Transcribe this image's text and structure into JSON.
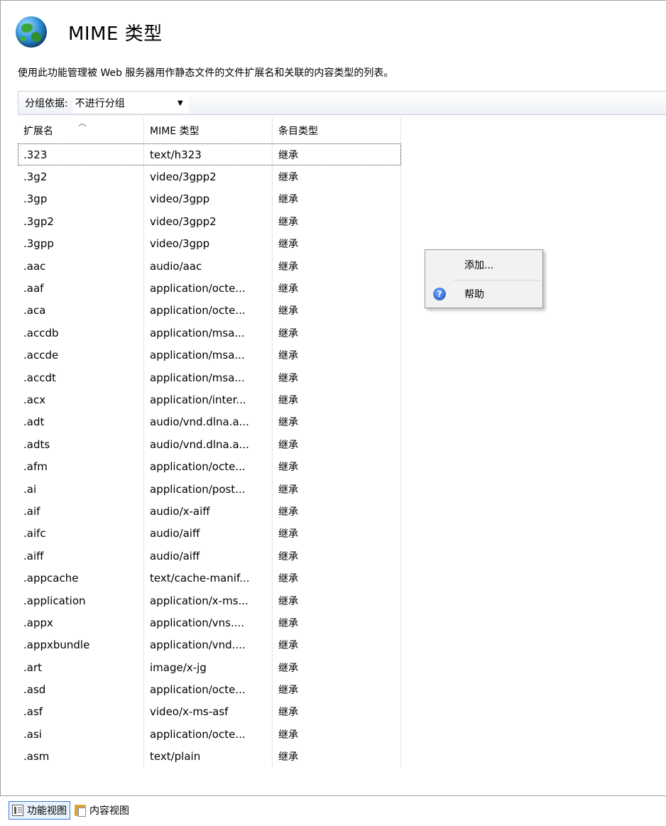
{
  "header": {
    "title": "MIME 类型",
    "icon": "globe-icon"
  },
  "description": "使用此功能管理被 Web 服务器用作静态文件的文件扩展名和关联的内容类型的列表。",
  "toolbar": {
    "group_by_label": "分组依据:",
    "group_by_value": "不进行分组"
  },
  "columns": {
    "extension": "扩展名",
    "mime_type": "MIME 类型",
    "entry_type": "条目类型"
  },
  "rows": [
    {
      "ext": ".323",
      "mime": "text/h323",
      "entry": "继承"
    },
    {
      "ext": ".3g2",
      "mime": "video/3gpp2",
      "entry": "继承"
    },
    {
      "ext": ".3gp",
      "mime": "video/3gpp",
      "entry": "继承"
    },
    {
      "ext": ".3gp2",
      "mime": "video/3gpp2",
      "entry": "继承"
    },
    {
      "ext": ".3gpp",
      "mime": "video/3gpp",
      "entry": "继承"
    },
    {
      "ext": ".aac",
      "mime": "audio/aac",
      "entry": "继承"
    },
    {
      "ext": ".aaf",
      "mime": "application/octe...",
      "entry": "继承"
    },
    {
      "ext": ".aca",
      "mime": "application/octe...",
      "entry": "继承"
    },
    {
      "ext": ".accdb",
      "mime": "application/msa...",
      "entry": "继承"
    },
    {
      "ext": ".accde",
      "mime": "application/msa...",
      "entry": "继承"
    },
    {
      "ext": ".accdt",
      "mime": "application/msa...",
      "entry": "继承"
    },
    {
      "ext": ".acx",
      "mime": "application/inter...",
      "entry": "继承"
    },
    {
      "ext": ".adt",
      "mime": "audio/vnd.dlna.a...",
      "entry": "继承"
    },
    {
      "ext": ".adts",
      "mime": "audio/vnd.dlna.a...",
      "entry": "继承"
    },
    {
      "ext": ".afm",
      "mime": "application/octe...",
      "entry": "继承"
    },
    {
      "ext": ".ai",
      "mime": "application/post...",
      "entry": "继承"
    },
    {
      "ext": ".aif",
      "mime": "audio/x-aiff",
      "entry": "继承"
    },
    {
      "ext": ".aifc",
      "mime": "audio/aiff",
      "entry": "继承"
    },
    {
      "ext": ".aiff",
      "mime": "audio/aiff",
      "entry": "继承"
    },
    {
      "ext": ".appcache",
      "mime": "text/cache-manif...",
      "entry": "继承"
    },
    {
      "ext": ".application",
      "mime": "application/x-ms...",
      "entry": "继承"
    },
    {
      "ext": ".appx",
      "mime": "application/vns....",
      "entry": "继承"
    },
    {
      "ext": ".appxbundle",
      "mime": "application/vnd....",
      "entry": "继承"
    },
    {
      "ext": ".art",
      "mime": "image/x-jg",
      "entry": "继承"
    },
    {
      "ext": ".asd",
      "mime": "application/octe...",
      "entry": "继承"
    },
    {
      "ext": ".asf",
      "mime": "video/x-ms-asf",
      "entry": "继承"
    },
    {
      "ext": ".asi",
      "mime": "application/octe...",
      "entry": "继承"
    },
    {
      "ext": ".asm",
      "mime": "text/plain",
      "entry": "继承"
    }
  ],
  "context_menu": {
    "add_label": "添加...",
    "help_label": "帮助",
    "help_icon": "help-icon"
  },
  "view_tabs": {
    "features_view": "功能视图",
    "content_view": "内容视图"
  },
  "colors": {
    "selection_outline": "#404040",
    "active_tab_border": "#3f7fd8",
    "toolbar_border": "#c9d0da"
  }
}
